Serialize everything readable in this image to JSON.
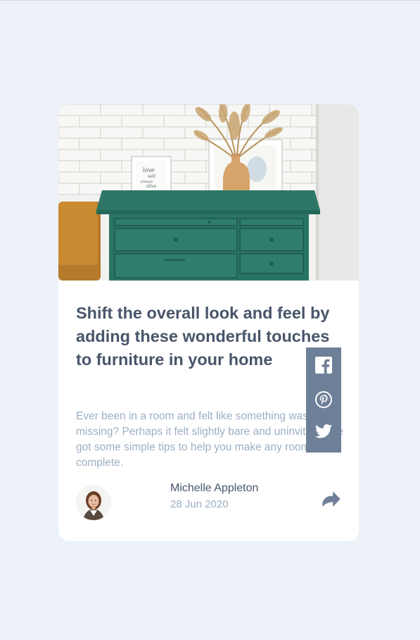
{
  "article": {
    "title": "Shift the overall look and feel by adding these wonderful touches to furniture in your home",
    "description": "Ever been in a room and felt like something was missing? Perhaps it felt slightly bare and uninviting. I’ve got some simple tips to help you make any room feel complete.",
    "image_text": [
      "love",
      "will",
      "always",
      "alive"
    ]
  },
  "author": {
    "name": "Michelle Appleton",
    "date": "28 Jun 2020"
  },
  "share": {
    "icons": [
      "facebook-icon",
      "pinterest-icon",
      "twitter-icon"
    ]
  },
  "colors": {
    "background": "#ecf2f8",
    "title": "#48556a",
    "muted": "#9eafc2",
    "share_panel": "#6e8098",
    "share_arrow": "#6e8098"
  }
}
